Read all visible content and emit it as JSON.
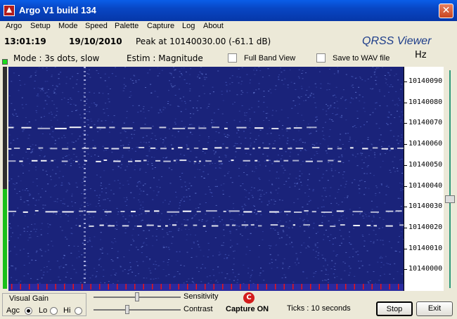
{
  "window": {
    "title": "Argo V1 build 134"
  },
  "menu": [
    "Argo",
    "Setup",
    "Mode",
    "Speed",
    "Palette",
    "Capture",
    "Log",
    "About"
  ],
  "info": {
    "time": "13:01:19",
    "date": "19/10/2010",
    "peak": "Peak at 10140030.00 (-61.1 dB)",
    "app_name": "QRSS Viewer"
  },
  "mode_bar": {
    "mode": "Mode : 3s dots, slow",
    "estim": "Estim : Magnitude",
    "full_band_label": "Full Band View",
    "full_band_checked": false,
    "save_wav_label": "Save to WAV file",
    "save_wav_checked": false,
    "unit": "Hz"
  },
  "frequency_labels": [
    "10140090",
    "10140080",
    "10140070",
    "10140060",
    "10140050",
    "10140040",
    "10140030",
    "10140020",
    "10140010",
    "10140000"
  ],
  "level_meter": {
    "fraction": 0.45
  },
  "visual_gain": {
    "title": "Visual Gain",
    "options": [
      "Agc",
      "Lo",
      "Hi"
    ],
    "selected": "Agc"
  },
  "sliders": {
    "sensitivity_label": "Sensitivity",
    "sensitivity_value": 0.5,
    "contrast_label": "Contrast",
    "contrast_value": 0.38
  },
  "capture": {
    "icon": "C",
    "status": "Capture ON"
  },
  "ticks": "Ticks  : 10 seconds",
  "buttons": {
    "stop": "Stop",
    "exit": "Exit"
  },
  "colors": {
    "waterfall_bg": "#1a237a",
    "signal": "#ffffff",
    "titlebar": "#0846c4"
  }
}
